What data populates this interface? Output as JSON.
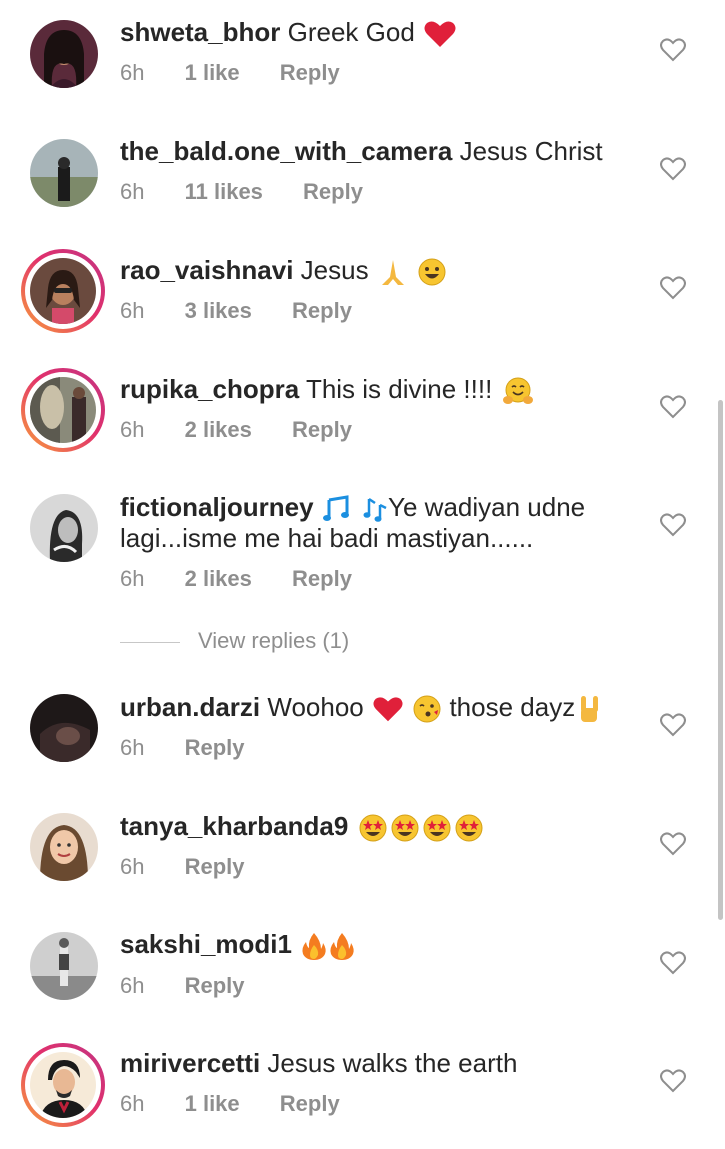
{
  "comments": [
    {
      "username": "shweta_bhor",
      "text": "Greek God",
      "emoji": [
        "heart"
      ],
      "time": "6h",
      "likes": "1 like",
      "reply": "Reply"
    },
    {
      "username": "the_bald.one_with_camera",
      "text": "Jesus Christ",
      "emoji": [],
      "time": "6h",
      "likes": "11 likes",
      "reply": "Reply"
    },
    {
      "username": "rao_vaishnavi",
      "text": "Jesus",
      "emoji": [
        "pray",
        "grin"
      ],
      "time": "6h",
      "likes": "3 likes",
      "reply": "Reply"
    },
    {
      "username": "rupika_chopra",
      "text": "This is divine !!!!",
      "emoji": [
        "hug"
      ],
      "time": "6h",
      "likes": "2 likes",
      "reply": "Reply"
    },
    {
      "username": "fictionaljourney",
      "text_prefix": "",
      "text_after_emoji": "Ye wadiyan udne",
      "text_line2": "lagi...isme me hai badi mastiyan......",
      "emoji": [
        "music-note",
        "music-notes"
      ],
      "time": "6h",
      "likes": "2 likes",
      "reply": "Reply"
    },
    {
      "username": "urban.darzi",
      "text": "Woohoo",
      "emoji": [
        "heart",
        "kiss"
      ],
      "text_after": "those dayz",
      "emoji_end": [
        "rock"
      ],
      "time": "6h",
      "likes": "",
      "reply": "Reply"
    },
    {
      "username": "tanya_kharbanda9",
      "text": "",
      "emoji": [
        "star-struck",
        "star-struck",
        "star-struck",
        "star-struck"
      ],
      "time": "6h",
      "likes": "",
      "reply": "Reply"
    },
    {
      "username": "sakshi_modi1",
      "text": "",
      "emoji": [
        "fire",
        "fire"
      ],
      "time": "6h",
      "likes": "",
      "reply": "Reply"
    },
    {
      "username": "mirivercetti",
      "text": "Jesus walks the earth",
      "emoji": [],
      "time": "6h",
      "likes": "1 like",
      "reply": "Reply"
    }
  ],
  "view_replies": "View replies (1)",
  "colors": {
    "text": "#262626",
    "meta": "#8e8e8e",
    "heart_red": "#e0203a",
    "story_ring_start": "#f9a03c",
    "story_ring_end": "#c13584"
  }
}
